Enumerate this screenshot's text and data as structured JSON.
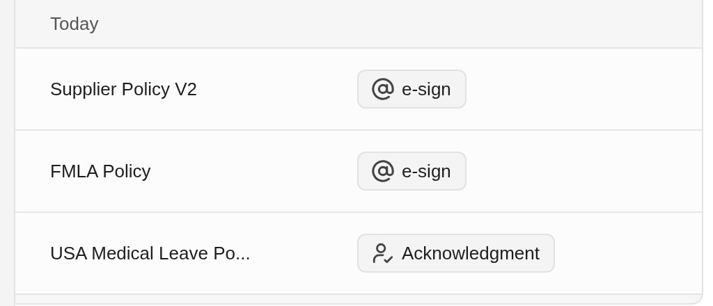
{
  "section": {
    "title": "Today"
  },
  "rows": [
    {
      "name": "Supplier Policy V2",
      "tag": {
        "kind": "esign",
        "label": "e-sign"
      }
    },
    {
      "name": "FMLA Policy",
      "tag": {
        "kind": "esign",
        "label": "e-sign"
      }
    },
    {
      "name": "USA Medical Leave Po...",
      "tag": {
        "kind": "acknowledgment",
        "label": "Acknowledgment"
      }
    }
  ]
}
